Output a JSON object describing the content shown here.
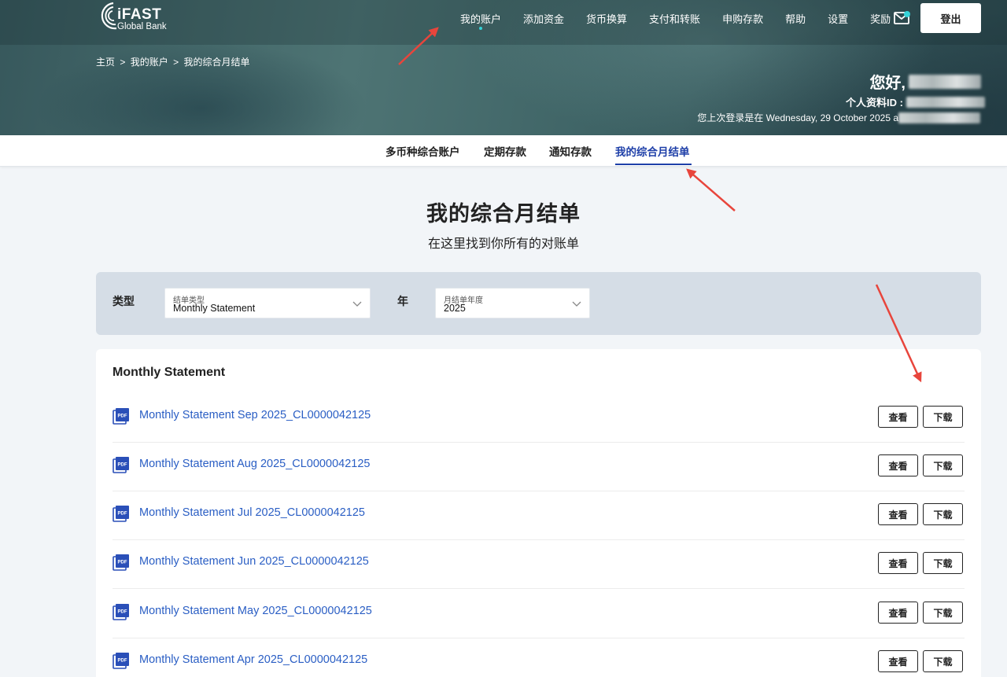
{
  "brand": {
    "name": "iFAST",
    "sub": "Global Bank"
  },
  "nav": {
    "items": [
      {
        "label": "我的账户",
        "active": true
      },
      {
        "label": "添加资金"
      },
      {
        "label": "货币换算"
      },
      {
        "label": "支付和转账"
      },
      {
        "label": "申购存款"
      },
      {
        "label": "帮助"
      },
      {
        "label": "设置"
      },
      {
        "label": "奖励"
      }
    ],
    "logout": "登出"
  },
  "breadcrumb": [
    "主页",
    ">",
    "我的账户",
    ">",
    "我的综合月结单"
  ],
  "user": {
    "greeting": "您好,",
    "profile_label": "个人资料ID :",
    "last_login": "您上次登录是在 Wednesday, 29 October 2025 a"
  },
  "subtabs": [
    {
      "label": "多币种综合账户"
    },
    {
      "label": "定期存款"
    },
    {
      "label": "通知存款"
    },
    {
      "label": "我的综合月结单",
      "active": true
    }
  ],
  "page": {
    "title": "我的综合月结单",
    "subtitle": "在这里找到你所有的对账单"
  },
  "filter": {
    "type_label": "类型",
    "type_select": {
      "label": "结单类型",
      "value": "Monthly Statement"
    },
    "year_label": "年",
    "year_select": {
      "label": "月结单年度",
      "value": "2025"
    }
  },
  "statements": {
    "heading": "Monthly Statement",
    "view_label": "查看",
    "download_label": "下载",
    "items": [
      "Monthly Statement Sep 2025_CL0000042125",
      "Monthly Statement Aug 2025_CL0000042125",
      "Monthly Statement Jul 2025_CL0000042125",
      "Monthly Statement Jun 2025_CL0000042125",
      "Monthly Statement May 2025_CL0000042125",
      "Monthly Statement Apr 2025_CL0000042125"
    ]
  },
  "colors": {
    "accent": "#1e3fa8",
    "link": "#2a5ec4",
    "annotation": "#e8453c",
    "dot": "#35d3d8"
  }
}
